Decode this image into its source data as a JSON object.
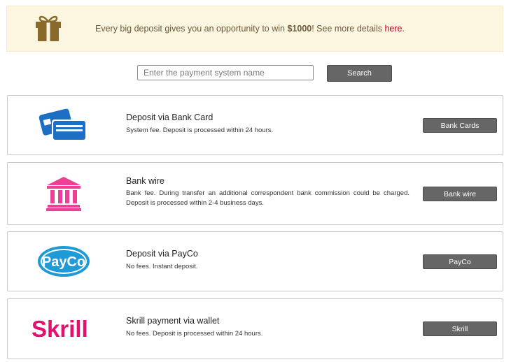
{
  "promo": {
    "text_before": "Every big deposit gives you an opportunity to win ",
    "amount": "$1000",
    "text_after": "! See more details ",
    "link": "here",
    "link_suffix": ".",
    "icon": "gift-icon"
  },
  "search": {
    "placeholder": "Enter the payment system name",
    "button_label": "Search"
  },
  "methods": [
    {
      "title": "Deposit via Bank Card",
      "description": "System fee. Deposit is processed within 24 hours.",
      "button_label": "Bank Cards",
      "icon": "bank-card-icon",
      "color": "#1d6fc4"
    },
    {
      "title": "Bank wire",
      "description": "Bank fee. During transfer an additional correspondent bank commission could be charged. Deposit is processed within 2-4 business days.",
      "button_label": "Bank wire",
      "icon": "bank-building-icon",
      "color": "#ee3f96"
    },
    {
      "title": "Deposit via PayCo",
      "description": "No fees. Instant deposit.",
      "button_label": "PayCo",
      "icon": "payco-logo",
      "logo_text": "PayCo",
      "color": "#1e9ad6"
    },
    {
      "title": "Skrill payment via wallet",
      "description": "No fees. Deposit is processed within 24 hours.",
      "button_label": "Skrill",
      "icon": "skrill-logo",
      "logo_text": "Skrill",
      "color": "#e5106d"
    }
  ]
}
